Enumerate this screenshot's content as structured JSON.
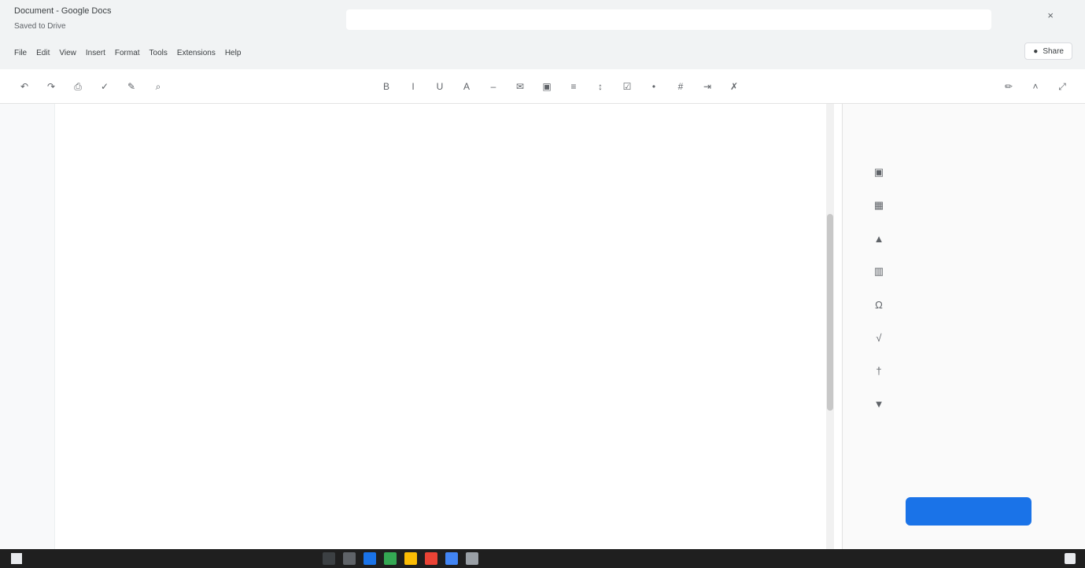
{
  "header": {
    "title": "Document - Google Docs",
    "meta": "Saved to Drive",
    "menus": [
      "File",
      "Edit",
      "View",
      "Insert",
      "Format",
      "Tools",
      "Extensions",
      "Help"
    ],
    "share_label": "Share",
    "close_glyph": "×"
  },
  "toolbar": {
    "left": [
      {
        "icon": "undo-icon",
        "glyph": "↶"
      },
      {
        "icon": "redo-icon",
        "glyph": "↷"
      },
      {
        "icon": "print-icon",
        "glyph": "⎙"
      },
      {
        "icon": "spellcheck-icon",
        "glyph": "✓"
      },
      {
        "icon": "paint-format-icon",
        "glyph": "✎"
      },
      {
        "icon": "zoom-icon",
        "glyph": "⌕"
      }
    ],
    "middle": [
      {
        "icon": "bold-icon",
        "glyph": "B"
      },
      {
        "icon": "italic-icon",
        "glyph": "I"
      },
      {
        "icon": "underline-icon",
        "glyph": "U"
      },
      {
        "icon": "text-color-icon",
        "glyph": "A"
      },
      {
        "icon": "link-icon",
        "glyph": "–"
      },
      {
        "icon": "comment-icon",
        "glyph": "✉"
      },
      {
        "icon": "image-icon",
        "glyph": "▣"
      },
      {
        "icon": "align-left-icon",
        "glyph": "≡"
      },
      {
        "icon": "line-spacing-icon",
        "glyph": "↕"
      },
      {
        "icon": "checklist-icon",
        "glyph": "☑"
      },
      {
        "icon": "bullet-list-icon",
        "glyph": "•"
      },
      {
        "icon": "numbered-list-icon",
        "glyph": "#"
      },
      {
        "icon": "indent-icon",
        "glyph": "⇥"
      },
      {
        "icon": "clear-format-icon",
        "glyph": "✗"
      }
    ],
    "right": [
      {
        "icon": "editing-mode-icon",
        "glyph": "✏"
      },
      {
        "icon": "collapse-icon",
        "glyph": "˄"
      },
      {
        "icon": "expand-icon",
        "glyph": "⤢"
      }
    ]
  },
  "document": {
    "heading": "",
    "paragraphs": [
      "",
      "",
      "",
      ""
    ]
  },
  "side_panel": {
    "label": "",
    "items": [
      {
        "label": "",
        "icon": "image-icon",
        "glyph": "▣"
      },
      {
        "label": "",
        "icon": "table-icon",
        "glyph": "▦"
      },
      {
        "label": "",
        "icon": "drawing-icon",
        "glyph": "▲"
      },
      {
        "label": "",
        "icon": "chart-icon",
        "glyph": "▥"
      },
      {
        "label": "",
        "icon": "special-characters-icon",
        "glyph": "Ω"
      },
      {
        "label": "",
        "icon": "equation-icon",
        "glyph": "√"
      },
      {
        "label": "",
        "icon": "footnote-icon",
        "glyph": "†"
      },
      {
        "label": "",
        "icon": "bookmark-icon",
        "glyph": "▼"
      }
    ],
    "note": "",
    "button_label": ""
  },
  "taskbar": {
    "status": "",
    "clock": "",
    "apps": [
      "#3c4043",
      "#5f6368",
      "#1a73e8",
      "#34a853",
      "#fbbc04",
      "#ea4335",
      "#4285f4",
      "#9aa0a6"
    ]
  }
}
